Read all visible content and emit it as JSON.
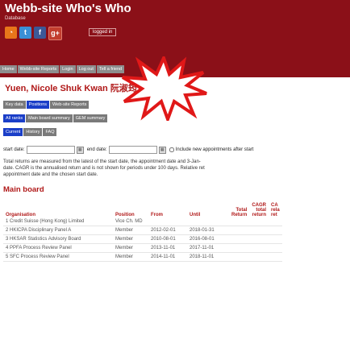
{
  "header": {
    "title": "Webb-site Who's Who",
    "subtitle": "Database",
    "login": "logged in",
    "social": [
      {
        "icon": "rss-icon",
        "glyph": "◔"
      },
      {
        "icon": "twitter-icon",
        "glyph": "t"
      },
      {
        "icon": "facebook-icon",
        "glyph": "f"
      },
      {
        "icon": "google-plus-icon",
        "glyph": "g+"
      }
    ],
    "nav": [
      "Home",
      "Webb-site Reports",
      "Login",
      "Log out",
      "Tell a friend"
    ]
  },
  "person": {
    "name": "Yuen, Nicole Shuk Kwan",
    "chinese": "阮淑筠"
  },
  "tabs_row1": [
    "Key data",
    "Positions",
    "Web-site Reports"
  ],
  "tabs_row2": [
    "All ranks",
    "Main board summary",
    "GEM summary"
  ],
  "tabs_row3": [
    "Current",
    "History",
    "FAQ"
  ],
  "filter": {
    "start_label": "start date:",
    "end_label": "end date:",
    "start_value": "",
    "end_value": "",
    "include_label": "Include new appointments after start"
  },
  "description": [
    "Total returns are measured from the latest of the start date, the appointment date and 3-Jan-",
    "date. CAGR is the annualised return and is not shown for periods under 100 days. Relative ret",
    "appointment date and the chosen start date."
  ],
  "section_title": "Main board",
  "table": {
    "headers": {
      "organisation": "Organisation",
      "position": "Position",
      "from": "From",
      "until": "Until",
      "total_return_1": "Total",
      "total_return_2": "Return",
      "cagr_1": "CAGR",
      "cagr_2": "total",
      "cagr_3": "return",
      "rel_1": "CA",
      "rel_2": "rela",
      "rel_3": "ret"
    },
    "rows": [
      {
        "n": "1",
        "org": "Credit Suisse (Hong Kong) Limited",
        "pos": "Vice Ch. MD",
        "from": "",
        "until": ""
      },
      {
        "n": "2",
        "org": "HKICPA Disciplinary Panel A",
        "pos": "Member",
        "from": "2012-02-01",
        "until": "2018-01-31"
      },
      {
        "n": "3",
        "org": "HKSAR Statistics Advisory Board",
        "pos": "Member",
        "from": "2010-08-01",
        "until": "2016-08-01"
      },
      {
        "n": "4",
        "org": "PPFA Process Review Panel",
        "pos": "Member",
        "from": "2013-11-01",
        "until": "2017-11-01"
      },
      {
        "n": "5",
        "org": "SFC Process Review Panel",
        "pos": "Member",
        "from": "2014-11-01",
        "until": "2018-11-01"
      }
    ]
  },
  "colors": {
    "header_bg": "#8b1018",
    "accent_red": "#b01818",
    "tab_blue": "#1a3ec8",
    "tab_grey": "#7a7a7a",
    "burst_fill": "#ffffff",
    "burst_stroke": "#e01818"
  }
}
